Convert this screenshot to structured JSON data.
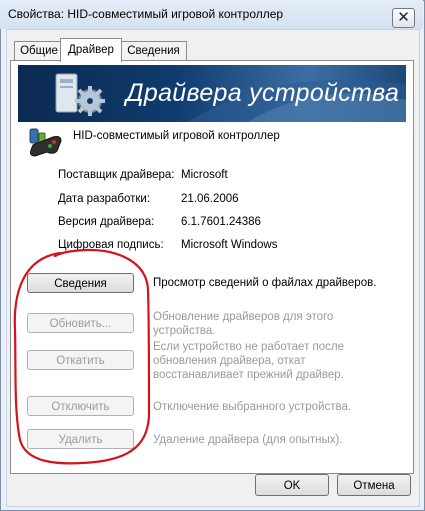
{
  "window": {
    "title": "Свойства: HID-совместимый игровой контроллер",
    "close_glyph": "✕"
  },
  "tabs": [
    {
      "label": "Общие",
      "active": false
    },
    {
      "label": "Драйвер",
      "active": true
    },
    {
      "label": "Сведения",
      "active": false
    }
  ],
  "banner": {
    "title": "Драйвера устройства"
  },
  "device": {
    "name": "HID-совместимый игровой контроллер",
    "icon": "gamepad-icon"
  },
  "info": [
    {
      "label": "Поставщик драйвера:",
      "value": "Microsoft"
    },
    {
      "label": "Дата разработки:",
      "value": "21.06.2006"
    },
    {
      "label": "Версия драйвера:",
      "value": "6.1.7601.24386"
    },
    {
      "label": "Цифровая подпись:",
      "value": "Microsoft Windows"
    }
  ],
  "actions": [
    {
      "label": "Сведения",
      "enabled": true,
      "description": [
        "Просмотр сведений о файлах драйверов."
      ]
    },
    {
      "label": "Обновить...",
      "enabled": false,
      "description": [
        "Обновление драйверов для этого",
        "устройства."
      ]
    },
    {
      "label": "Откатить",
      "enabled": false,
      "description": [
        "Если устройство не работает после",
        "обновления драйвера, откат",
        "восстанавливает прежний драйвер."
      ]
    },
    {
      "label": "Отключить",
      "enabled": false,
      "description": [
        "Отключение выбранного устройства."
      ]
    },
    {
      "label": "Удалить",
      "enabled": false,
      "description": [
        "Удаление драйвера (для опытных)."
      ]
    }
  ],
  "footer": {
    "ok_label": "OK",
    "cancel_label": "Отмена"
  },
  "colors": {
    "annotation_red": "#d3141a",
    "banner_dark": "#0b2a52"
  }
}
